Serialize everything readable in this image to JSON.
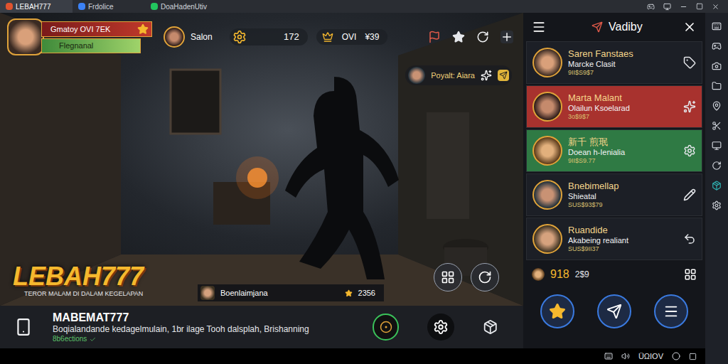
{
  "tabs": [
    {
      "label": "LEBAH777",
      "selected": true
    },
    {
      "label": "Frdolice",
      "selected": false
    },
    {
      "label": "DoaHadenUtiv",
      "selected": false
    }
  ],
  "hud": {
    "player": {
      "name": "Gmatoy OVI 7EK",
      "title": "Flegnanal"
    },
    "rival": "Salon",
    "coins": "172",
    "crown": "OVI",
    "gems": "¥39",
    "notice": "Poyalt: Aiara"
  },
  "logo": {
    "title": "LEBAH777",
    "subtitle": "TEROR MALAM DI DALAM KEGELAPAN"
  },
  "chip": {
    "name": "Boenlaimjana",
    "score": "2356"
  },
  "bottom_bar": {
    "title": "MABEMAT777",
    "text": "Boqialandande kedagelmulain, 1br ilage Tooh dalsplah, Brishanning",
    "sub": "8b6ections"
  },
  "panel": {
    "title": "Vadiby",
    "items": [
      {
        "name": "Saren Fanstaes",
        "subtitle": "Marcke Clasit",
        "code": "9II$S9$7",
        "color": "#1c1f26"
      },
      {
        "name": "Marta Malant",
        "subtitle": "Olailun Ksoelarad",
        "code": "3o$9$7",
        "color": "#a8322e"
      },
      {
        "name": "新千 煎珉",
        "subtitle": "Doean h-Ienialia",
        "code": "9II$S9.77",
        "color": "#2f7a44"
      },
      {
        "name": "Bnebimellap",
        "subtitle": "Shieatal",
        "code": "SUS$93$79",
        "color": "#1c1f26"
      },
      {
        "name": "Ruandide",
        "subtitle": "Akabeing realiant",
        "code": "SUS$9II37",
        "color": "#1c1f26"
      }
    ],
    "stats": {
      "value": "918",
      "extra": "2$9"
    }
  },
  "status_bar": {
    "text": "ÜΩIOV"
  }
}
